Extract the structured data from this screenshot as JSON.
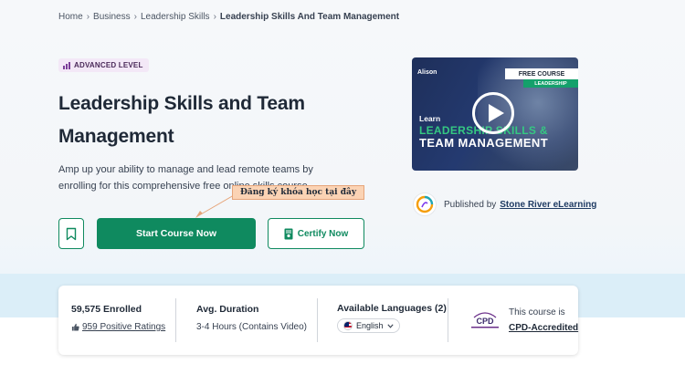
{
  "breadcrumb": {
    "home": "Home",
    "business": "Business",
    "leadership": "Leadership Skills",
    "current": "Leadership Skills And Team Management"
  },
  "course": {
    "level": "ADVANCED LEVEL",
    "title": "Leadership Skills and Team Management",
    "description": "Amp up your ability to manage and lead remote teams by enrolling for this comprehensive free online skills course."
  },
  "annotation": {
    "text": "Đăng ký khóa học tại đây"
  },
  "actions": {
    "start_label": "Start Course Now",
    "certify_label": "Certify Now"
  },
  "thumbnail": {
    "brand": "Alison",
    "free_course": "FREE COURSE",
    "category": "LEADERSHIP",
    "learn": "Learn",
    "line1": "LEADERSHIP SKILLS &",
    "line2": "TEAM MANAGEMENT"
  },
  "publisher": {
    "prefix": "Published by",
    "name": "Stone River eLearning"
  },
  "stats": {
    "enrolled": "59,575 Enrolled",
    "ratings": "959 Positive Ratings",
    "duration_title": "Avg. Duration",
    "duration_value": "3-4 Hours (Contains Video)",
    "languages_title": "Available Languages (2)",
    "language_selected": "English",
    "cpd_prefix": "This course is",
    "cpd_status": "CPD-Accredited",
    "cpd_logo_text": "CPD"
  },
  "colors": {
    "accent_green": "#0f8a5f",
    "badge_purple": "#7b3f99",
    "annotation_bg": "#fbd3b4"
  }
}
